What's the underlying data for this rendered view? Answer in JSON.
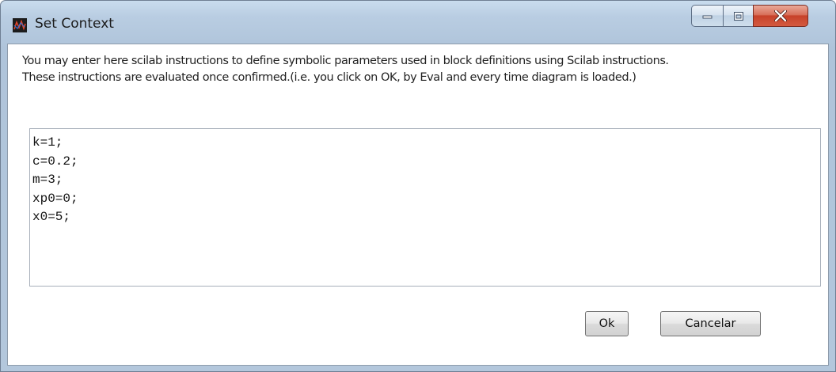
{
  "window": {
    "title": "Set Context",
    "icon": "scilab-app-icon",
    "controls": [
      "minimize-icon",
      "maximize-icon",
      "close-icon"
    ]
  },
  "dialog": {
    "instructions_line1": "You may enter here scilab instructions to define symbolic parameters used in block definitions using Scilab instructions.",
    "instructions_line2": "These instructions are evaluated once confirmed.(i.e. you click on OK, by Eval and every time diagram is loaded.)",
    "context_lines": [
      "k=1;",
      "c=0.2;",
      "m=3;",
      "xp0=0;",
      "x0=5;"
    ]
  },
  "buttons": {
    "ok_label": "Ok",
    "cancel_label": "Cancelar"
  },
  "colors": {
    "title_bar": "#b9cde2",
    "close_button": "#c7412a"
  }
}
